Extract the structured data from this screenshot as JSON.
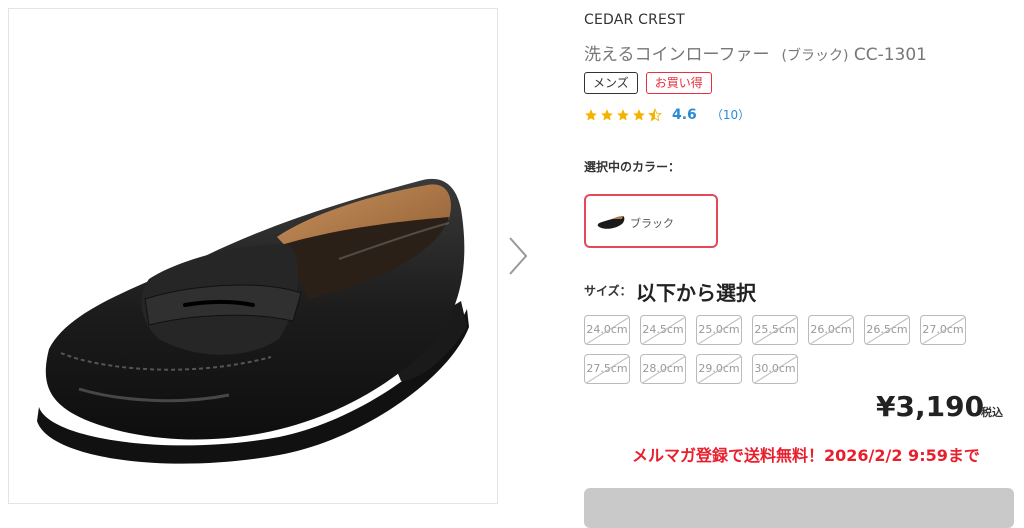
{
  "product": {
    "brand": "CEDAR CREST",
    "name": "洗えるコインローファー",
    "color_suffix": "(ブラック)",
    "model": "CC-1301",
    "tags": [
      {
        "label": "メンズ",
        "style": "default"
      },
      {
        "label": "お買い得",
        "style": "red"
      }
    ],
    "rating": {
      "stars": 4.5,
      "value": "4.6",
      "count": "（10）"
    }
  },
  "color_select": {
    "label": "選択中のカラー：",
    "selected": "ブラック"
  },
  "size_select": {
    "label": "サイズ：",
    "prompt": "以下から選択",
    "sizes": [
      "24.0cm",
      "24.5cm",
      "25.0cm",
      "25.5cm",
      "26.0cm",
      "26.5cm",
      "27.0cm",
      "27.5cm",
      "28.0cm",
      "29.0cm",
      "30.0cm"
    ],
    "all_unavailable": true
  },
  "pricing": {
    "price": "¥3,190",
    "tax_label": "税込",
    "promo": "メルマガ登録で送料無料！2026/2/2 9:59まで"
  },
  "colors": {
    "accent_red": "#e8202e",
    "swatch_border": "#e8475a",
    "rating_blue": "#2a8bd4",
    "star": "#f5b301",
    "disabled_button": "#c9c9c9"
  },
  "icons": {
    "next": "chevron-right-icon",
    "star": "star-icon"
  }
}
